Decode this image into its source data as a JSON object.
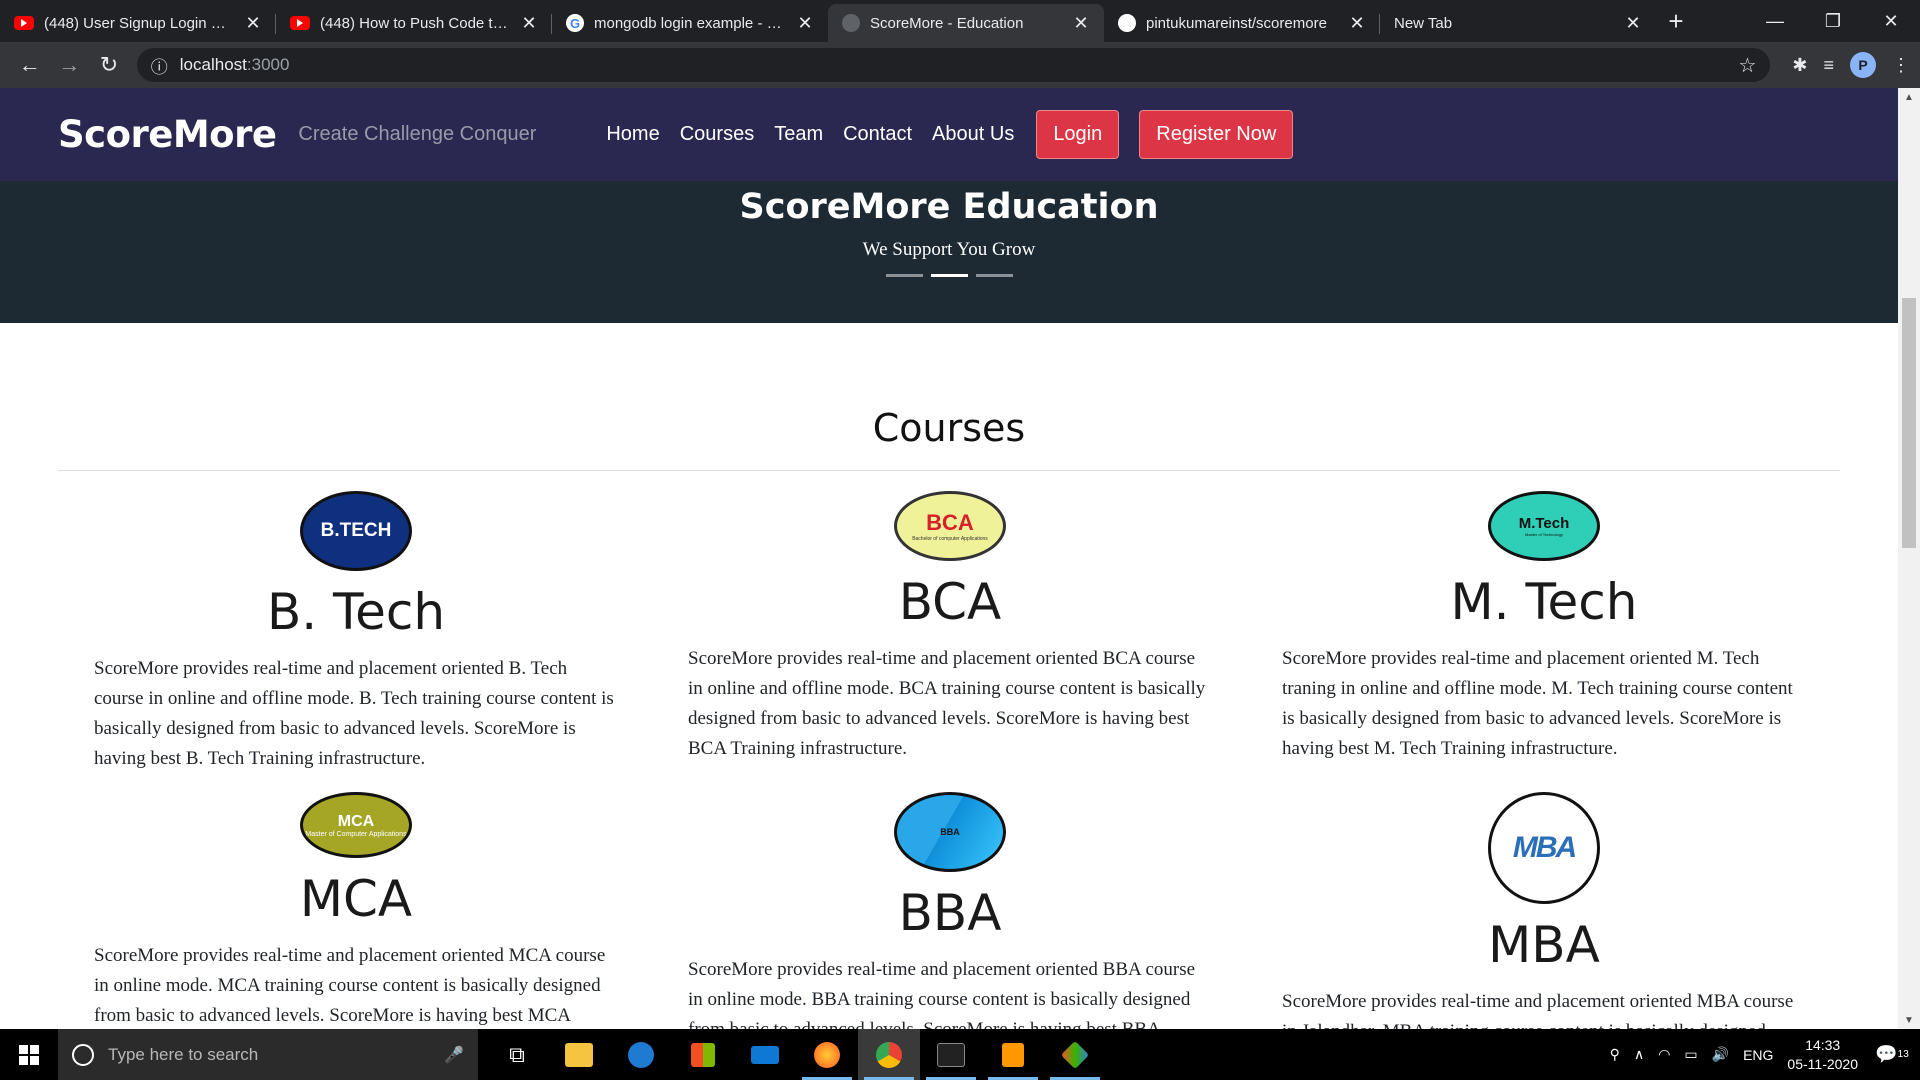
{
  "browser": {
    "tabs": [
      {
        "title": "(448) User Signup Login Logout",
        "favicon": "youtube-icon",
        "active": false
      },
      {
        "title": "(448) How to Push Code to GitHub",
        "favicon": "youtube-icon",
        "active": false
      },
      {
        "title": "mongodb login example - Google",
        "favicon": "google-icon",
        "active": false
      },
      {
        "title": "ScoreMore - Education",
        "favicon": "globe-icon",
        "active": true
      },
      {
        "title": "pintukumareinst/scoremore",
        "favicon": "github-icon",
        "active": false
      },
      {
        "title": "New Tab",
        "favicon": "",
        "active": false
      }
    ],
    "url_host": "localhost",
    "url_port": ":3000"
  },
  "site": {
    "brand": "ScoreMore",
    "tagline": "Create Challenge Conquer",
    "menu": [
      "Home",
      "Courses",
      "Team",
      "Contact",
      "About Us"
    ],
    "login": "Login",
    "register": "Register Now",
    "hero_title": "ScoreMore Education",
    "hero_subtitle": "We Support You Grow",
    "section_title": "Courses"
  },
  "courses": [
    {
      "logo_text": "B.TECH",
      "logo_sub": "",
      "name": "B. Tech",
      "desc": "ScoreMore provides real-time and placement oriented B. Tech course in online and offline mode. B. Tech training course content is basically designed from basic to advanced levels. ScoreMore is having best B. Tech Training infrastructure."
    },
    {
      "logo_text": "BCA",
      "logo_sub": "Bachelor of computer Applications",
      "name": "BCA",
      "desc": "ScoreMore provides real-time and placement oriented BCA course in online and offline mode. BCA training course content is basically designed from basic to advanced levels. ScoreMore is having best BCA Training infrastructure."
    },
    {
      "logo_text": "M.Tech",
      "logo_sub": "Master of Technology",
      "name": "M. Tech",
      "desc": "ScoreMore provides real-time and placement oriented M. Tech traning in online and offline mode. M. Tech training course content is basically designed from basic to advanced levels. ScoreMore is having best M. Tech Training infrastructure."
    },
    {
      "logo_text": "MCA",
      "logo_sub": "Master of Computer Applications",
      "name": "MCA",
      "desc": "ScoreMore provides real-time and placement oriented MCA course in online mode. MCA training course content is basically designed from basic to advanced levels. ScoreMore is having best MCA Training infrastructure."
    },
    {
      "logo_text": "BBA",
      "logo_sub": "",
      "name": "BBA",
      "desc": "ScoreMore provides real-time and placement oriented BBA course in online mode. BBA training course content is basically designed from basic to advanced levels. ScoreMore is having best BBA Training infrastructure."
    },
    {
      "logo_text": "MBA",
      "logo_sub": "",
      "name": "MBA",
      "desc": "ScoreMore provides real-time and placement oriented MBA course in Jalandhar. MBA training course content is basically designed from basic to advanced levels."
    }
  ],
  "taskbar": {
    "search_placeholder": "Type here to search",
    "lang": "ENG",
    "time": "14:33",
    "date": "05-11-2020",
    "notifications": "13"
  }
}
